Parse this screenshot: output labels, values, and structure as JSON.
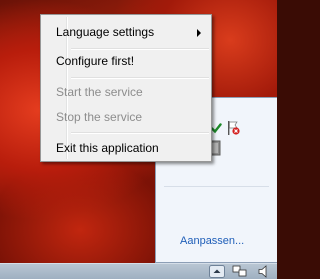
{
  "context_menu": {
    "items": [
      {
        "label": "Language settings",
        "has_submenu": true,
        "enabled": true
      },
      {
        "label": "Configure first!",
        "enabled": true
      },
      {
        "label": "Start the service",
        "enabled": false
      },
      {
        "label": "Stop the service",
        "enabled": false
      },
      {
        "label": "Exit this application",
        "enabled": true
      }
    ]
  },
  "tray_flyout": {
    "icons": [
      "green-check-shield-icon",
      "red-flag-icon",
      "green-check-icon",
      "gray-app-icon"
    ],
    "customize_label": "Aanpassen..."
  },
  "taskbar": {
    "icons": [
      "show-hidden-icons-button",
      "network-icon",
      "volume-icon"
    ]
  },
  "colors": {
    "menu_bg": "#f0f0f0",
    "link": "#1f5eb8",
    "disabled_text": "#8d8d8d"
  }
}
